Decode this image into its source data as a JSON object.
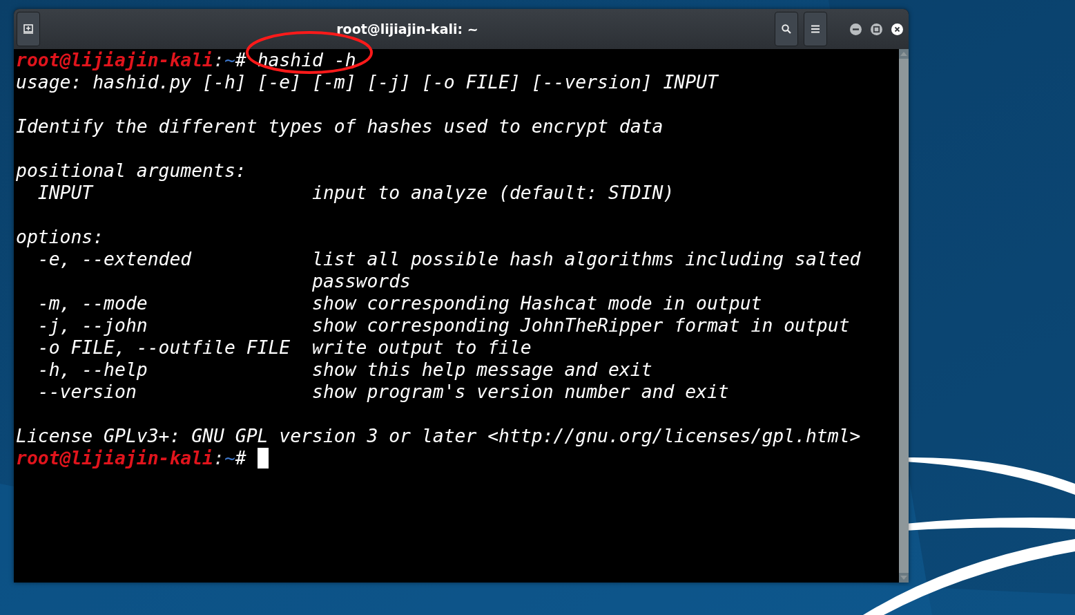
{
  "window": {
    "title": "root@lijiajin-kali: ~"
  },
  "terminal": {
    "lines": [
      {
        "kind": "prompt",
        "user_host": "root@lijiajin-kali",
        "separator": ":",
        "path": "~",
        "symbol": "#",
        "command": "hashid -h",
        "cursor": false
      },
      {
        "kind": "output",
        "text": "usage: hashid.py [-h] [-e] [-m] [-j] [-o FILE] [--version] INPUT"
      },
      {
        "kind": "blank"
      },
      {
        "kind": "output",
        "text": "Identify the different types of hashes used to encrypt data"
      },
      {
        "kind": "blank"
      },
      {
        "kind": "output",
        "text": "positional arguments:"
      },
      {
        "kind": "output",
        "text": "  INPUT                    input to analyze (default: STDIN)"
      },
      {
        "kind": "blank"
      },
      {
        "kind": "output",
        "text": "options:"
      },
      {
        "kind": "output",
        "text": "  -e, --extended           list all possible hash algorithms including salted"
      },
      {
        "kind": "output",
        "text": "                           passwords"
      },
      {
        "kind": "output",
        "text": "  -m, --mode               show corresponding Hashcat mode in output"
      },
      {
        "kind": "output",
        "text": "  -j, --john               show corresponding JohnTheRipper format in output"
      },
      {
        "kind": "output",
        "text": "  -o FILE, --outfile FILE  write output to file"
      },
      {
        "kind": "output",
        "text": "  -h, --help               show this help message and exit"
      },
      {
        "kind": "output",
        "text": "  --version                show program's version number and exit"
      },
      {
        "kind": "blank"
      },
      {
        "kind": "output",
        "text": "License GPLv3+: GNU GPL version 3 or later <http://gnu.org/licenses/gpl.html>"
      },
      {
        "kind": "prompt",
        "user_host": "root@lijiajin-kali",
        "separator": ":",
        "path": "~",
        "symbol": "#",
        "cursor": true
      }
    ]
  }
}
